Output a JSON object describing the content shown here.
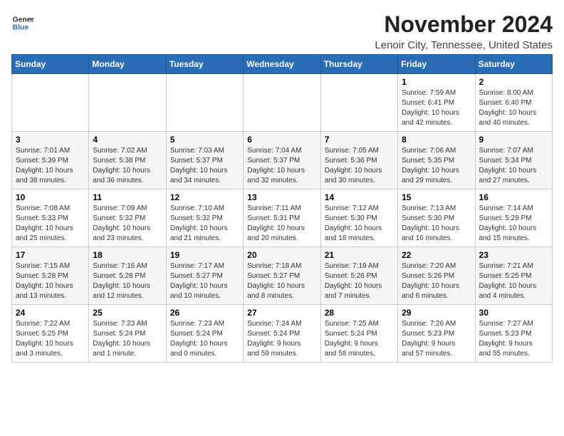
{
  "header": {
    "logo_line1": "General",
    "logo_line2": "Blue",
    "month_title": "November 2024",
    "location": "Lenoir City, Tennessee, United States"
  },
  "days_of_week": [
    "Sunday",
    "Monday",
    "Tuesday",
    "Wednesday",
    "Thursday",
    "Friday",
    "Saturday"
  ],
  "weeks": [
    [
      {
        "day": "",
        "info": ""
      },
      {
        "day": "",
        "info": ""
      },
      {
        "day": "",
        "info": ""
      },
      {
        "day": "",
        "info": ""
      },
      {
        "day": "",
        "info": ""
      },
      {
        "day": "1",
        "info": "Sunrise: 7:59 AM\nSunset: 6:41 PM\nDaylight: 10 hours\nand 42 minutes."
      },
      {
        "day": "2",
        "info": "Sunrise: 8:00 AM\nSunset: 6:40 PM\nDaylight: 10 hours\nand 40 minutes."
      }
    ],
    [
      {
        "day": "3",
        "info": "Sunrise: 7:01 AM\nSunset: 5:39 PM\nDaylight: 10 hours\nand 38 minutes."
      },
      {
        "day": "4",
        "info": "Sunrise: 7:02 AM\nSunset: 5:38 PM\nDaylight: 10 hours\nand 36 minutes."
      },
      {
        "day": "5",
        "info": "Sunrise: 7:03 AM\nSunset: 5:37 PM\nDaylight: 10 hours\nand 34 minutes."
      },
      {
        "day": "6",
        "info": "Sunrise: 7:04 AM\nSunset: 5:37 PM\nDaylight: 10 hours\nand 32 minutes."
      },
      {
        "day": "7",
        "info": "Sunrise: 7:05 AM\nSunset: 5:36 PM\nDaylight: 10 hours\nand 30 minutes."
      },
      {
        "day": "8",
        "info": "Sunrise: 7:06 AM\nSunset: 5:35 PM\nDaylight: 10 hours\nand 29 minutes."
      },
      {
        "day": "9",
        "info": "Sunrise: 7:07 AM\nSunset: 5:34 PM\nDaylight: 10 hours\nand 27 minutes."
      }
    ],
    [
      {
        "day": "10",
        "info": "Sunrise: 7:08 AM\nSunset: 5:33 PM\nDaylight: 10 hours\nand 25 minutes."
      },
      {
        "day": "11",
        "info": "Sunrise: 7:09 AM\nSunset: 5:32 PM\nDaylight: 10 hours\nand 23 minutes."
      },
      {
        "day": "12",
        "info": "Sunrise: 7:10 AM\nSunset: 5:32 PM\nDaylight: 10 hours\nand 21 minutes."
      },
      {
        "day": "13",
        "info": "Sunrise: 7:11 AM\nSunset: 5:31 PM\nDaylight: 10 hours\nand 20 minutes."
      },
      {
        "day": "14",
        "info": "Sunrise: 7:12 AM\nSunset: 5:30 PM\nDaylight: 10 hours\nand 18 minutes."
      },
      {
        "day": "15",
        "info": "Sunrise: 7:13 AM\nSunset: 5:30 PM\nDaylight: 10 hours\nand 16 minutes."
      },
      {
        "day": "16",
        "info": "Sunrise: 7:14 AM\nSunset: 5:29 PM\nDaylight: 10 hours\nand 15 minutes."
      }
    ],
    [
      {
        "day": "17",
        "info": "Sunrise: 7:15 AM\nSunset: 5:28 PM\nDaylight: 10 hours\nand 13 minutes."
      },
      {
        "day": "18",
        "info": "Sunrise: 7:16 AM\nSunset: 5:28 PM\nDaylight: 10 hours\nand 12 minutes."
      },
      {
        "day": "19",
        "info": "Sunrise: 7:17 AM\nSunset: 5:27 PM\nDaylight: 10 hours\nand 10 minutes."
      },
      {
        "day": "20",
        "info": "Sunrise: 7:18 AM\nSunset: 5:27 PM\nDaylight: 10 hours\nand 8 minutes."
      },
      {
        "day": "21",
        "info": "Sunrise: 7:19 AM\nSunset: 5:26 PM\nDaylight: 10 hours\nand 7 minutes."
      },
      {
        "day": "22",
        "info": "Sunrise: 7:20 AM\nSunset: 5:26 PM\nDaylight: 10 hours\nand 6 minutes."
      },
      {
        "day": "23",
        "info": "Sunrise: 7:21 AM\nSunset: 5:25 PM\nDaylight: 10 hours\nand 4 minutes."
      }
    ],
    [
      {
        "day": "24",
        "info": "Sunrise: 7:22 AM\nSunset: 5:25 PM\nDaylight: 10 hours\nand 3 minutes."
      },
      {
        "day": "25",
        "info": "Sunrise: 7:23 AM\nSunset: 5:24 PM\nDaylight: 10 hours\nand 1 minute."
      },
      {
        "day": "26",
        "info": "Sunrise: 7:23 AM\nSunset: 5:24 PM\nDaylight: 10 hours\nand 0 minutes."
      },
      {
        "day": "27",
        "info": "Sunrise: 7:24 AM\nSunset: 5:24 PM\nDaylight: 9 hours\nand 59 minutes."
      },
      {
        "day": "28",
        "info": "Sunrise: 7:25 AM\nSunset: 5:24 PM\nDaylight: 9 hours\nand 58 minutes."
      },
      {
        "day": "29",
        "info": "Sunrise: 7:26 AM\nSunset: 5:23 PM\nDaylight: 9 hours\nand 57 minutes."
      },
      {
        "day": "30",
        "info": "Sunrise: 7:27 AM\nSunset: 5:23 PM\nDaylight: 9 hours\nand 55 minutes."
      }
    ]
  ]
}
